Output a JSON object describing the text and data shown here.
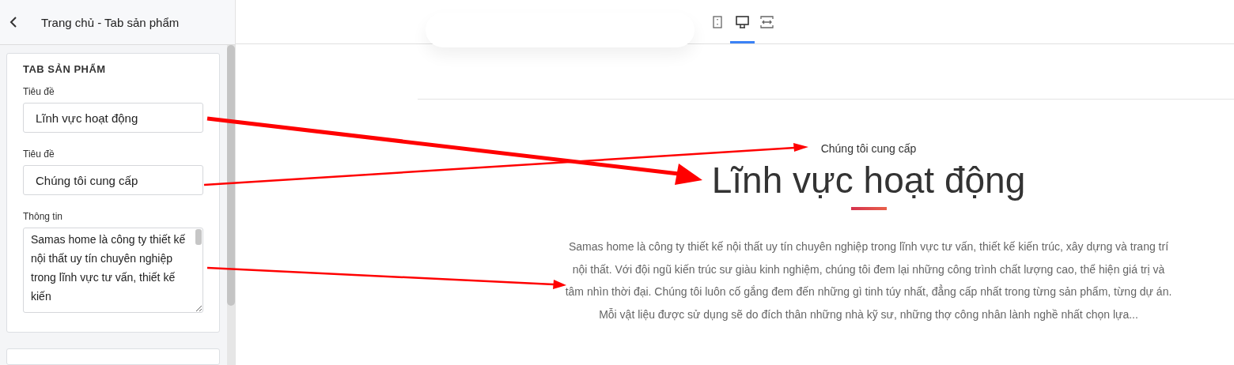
{
  "header": {
    "title": "Trang chủ - Tab sản phẩm"
  },
  "section": {
    "heading": "TAB SẢN PHẨM",
    "fields": [
      {
        "kind": "input",
        "label": "Tiêu đề",
        "value": "Lĩnh vực hoạt động"
      },
      {
        "kind": "input",
        "label": "Tiêu đề",
        "value": "Chúng tôi cung cấp"
      },
      {
        "kind": "textarea",
        "label": "Thông tin",
        "value": "Samas home là công ty thiết kế nội thất uy tín chuyên nghiệp trong lĩnh vực tư vấn, thiết kế kiến"
      }
    ]
  },
  "devices": [
    {
      "kind": "mobile",
      "selected": false
    },
    {
      "kind": "desktop",
      "selected": true
    },
    {
      "kind": "fullwidth",
      "selected": false
    }
  ],
  "preview": {
    "subtitle": "Chúng tôi cung cấp",
    "title": "Lĩnh vực hoạt động",
    "paragraph": "Samas home là công ty thiết kế nội thất uy tín chuyên nghiệp trong lĩnh vực tư vấn, thiết kế kiến trúc, xây dựng và trang trí nội thất. Với đội ngũ kiến trúc sư giàu kinh nghiệm, chúng tôi đem lại những công trình chất lượng cao, thể hiện giá trị và tâm nhìn thời đại. Chúng tôi luôn cố gắng đem đến những gì tinh túy nhất, đẳng cấp nhất trong từng sản phẩm, từng dự án. Mỗi vật liệu được sử dụng sẽ do đích thân những nhà kỹ sư, những thợ công nhân lành nghề nhất chọn lựa..."
  }
}
